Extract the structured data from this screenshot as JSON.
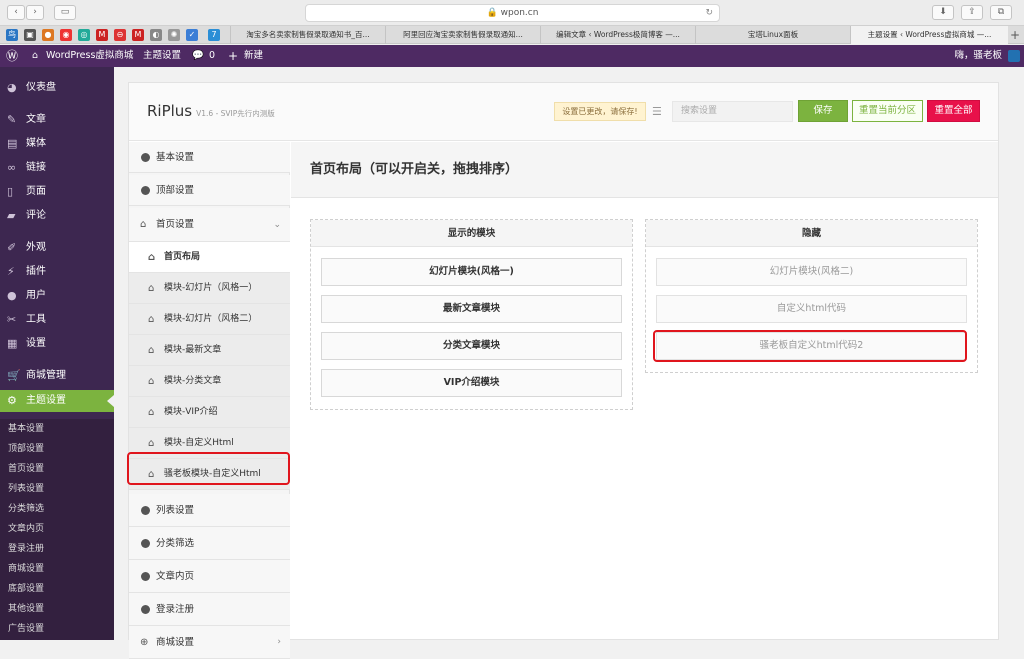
{
  "browser": {
    "url": "wpon.cn",
    "tabs": [
      "淘宝多名卖家制售假录取通知书_百...",
      "阿里回应淘宝卖家制售假录取通知...",
      "编辑文章 ‹ WordPress极简博客 —...",
      "宝塔Linux面板",
      "主题设置 ‹ WordPress虚拟商城 —..."
    ]
  },
  "adminbar": {
    "site_name": "WordPress虚拟商城",
    "theme_settings": "主题设置",
    "comments_count": "0",
    "new_label": "新建",
    "greeting": "嗨，骚老板"
  },
  "sidebar": {
    "items": [
      {
        "label": "仪表盘",
        "icon": "dashboard-icon"
      },
      {
        "label": "文章",
        "icon": "pin-icon"
      },
      {
        "label": "媒体",
        "icon": "media-icon"
      },
      {
        "label": "链接",
        "icon": "link-icon"
      },
      {
        "label": "页面",
        "icon": "page-icon"
      },
      {
        "label": "评论",
        "icon": "comment-icon"
      },
      {
        "label": "外观",
        "icon": "brush-icon"
      },
      {
        "label": "插件",
        "icon": "plugin-icon"
      },
      {
        "label": "用户",
        "icon": "user-icon"
      },
      {
        "label": "工具",
        "icon": "wrench-icon"
      },
      {
        "label": "设置",
        "icon": "settings-icon"
      },
      {
        "label": "商城管理",
        "icon": "cart-icon"
      },
      {
        "label": "主题设置",
        "icon": "gear-icon"
      }
    ],
    "subitems": [
      "基本设置",
      "顶部设置",
      "首页设置",
      "列表设置",
      "分类筛选",
      "文章内页",
      "登录注册",
      "商城设置",
      "底部设置",
      "其他设置",
      "广告设置"
    ]
  },
  "header": {
    "brand": "RiPlus",
    "version": "V1.6 - SVIP先行内测版",
    "notice": "设置已更改，请保存!",
    "search_placeholder": "搜索设置",
    "save": "保存",
    "reset_section": "重置当前分区",
    "reset_all": "重置全部"
  },
  "nav": {
    "basic": "基本设置",
    "top": "顶部设置",
    "home": "首页设置",
    "home_layout": "首页布局",
    "slider1": "模块-幻灯片（风格一）",
    "slider2": "模块-幻灯片（风格二）",
    "latest": "模块-最新文章",
    "category": "模块-分类文章",
    "vip": "模块-VIP介绍",
    "custom_html": "模块-自定义Html",
    "boss_custom": "骚老板模块-自定义Html",
    "list": "列表设置",
    "filter": "分类筛选",
    "article": "文章内页",
    "login": "登录注册",
    "shop": "商城设置"
  },
  "content": {
    "title": "首页布局（可以开启关，拖拽排序）",
    "enabled_title": "显示的模块",
    "enabled": [
      "幻灯片模块(风格一)",
      "最新文章模块",
      "分类文章模块",
      "VIP介绍模块"
    ],
    "hidden_title": "隐藏",
    "hidden": [
      "幻灯片模块(风格二)",
      "自定义html代码",
      "骚老板自定义html代码2"
    ]
  }
}
